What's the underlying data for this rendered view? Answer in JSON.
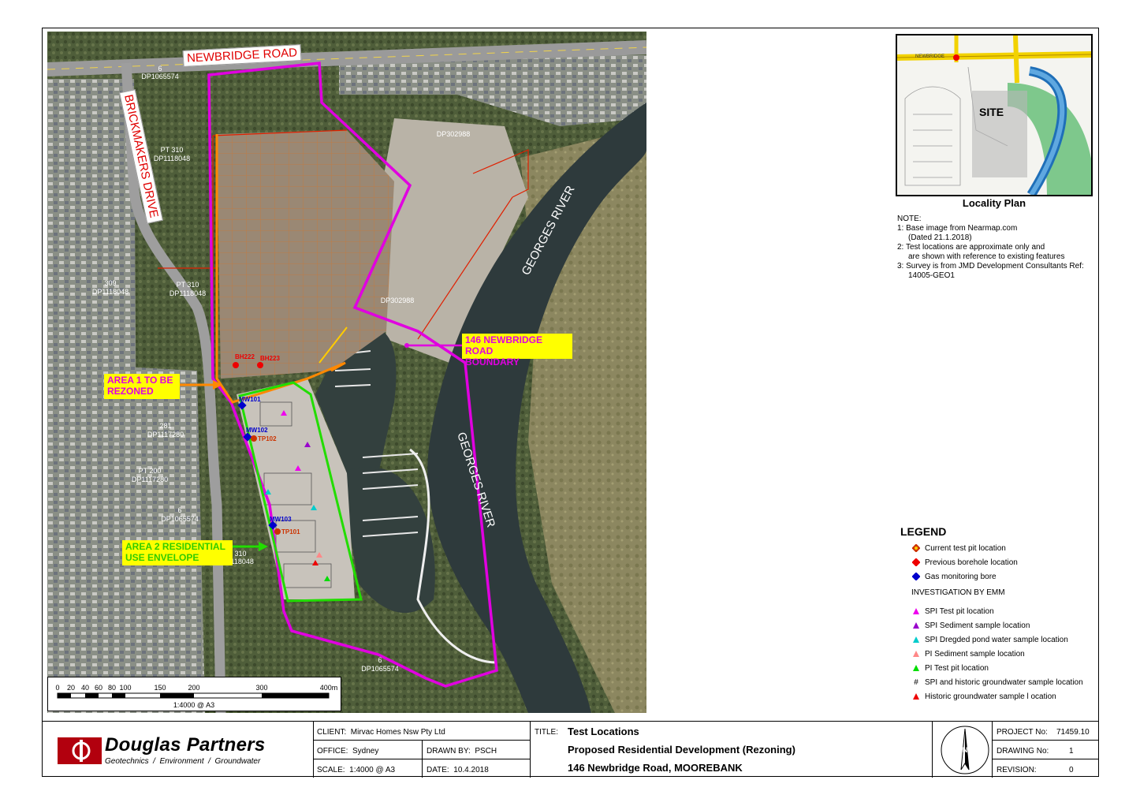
{
  "map": {
    "roads": {
      "newbridge": "NEWBRIDGE ROAD",
      "brickmakers": "BRICKMAKERS DRIVE"
    },
    "lots": [
      "6",
      "DP1065574",
      "PT 310",
      "DP1118048",
      "309",
      "DP1118048",
      "PT 310",
      "DP1118048",
      "DP302988",
      "DP302988",
      "281",
      "DP1117280",
      "PT 200",
      "DP1117280",
      "6",
      "DP1065574",
      "310",
      "1118048",
      "6",
      "DP1065574"
    ],
    "river": [
      "GEORGES RIVER",
      "GEORGES RIVER"
    ],
    "callouts": {
      "boundary": "146 NEWBRIDGE ROAD BOUNDARY",
      "boundary_l1": "146 NEWBRIDGE ROAD",
      "boundary_l2": "BOUNDARY",
      "area1_l1": "AREA 1 TO BE",
      "area1_l2": "REZONED",
      "area2_l1": "AREA 2 RESIDENTIAL",
      "area2_l2": "USE ENVELOPE"
    },
    "points": [
      "BH222",
      "BH223",
      "MW101",
      "MW102",
      "TP102",
      "MW103",
      "TP101"
    ],
    "colors": {
      "boundary": "#e000e0",
      "area1": "#ff8800",
      "area2": "#22dd00",
      "lots": "#dd2200"
    }
  },
  "scale_bar": {
    "ticks": [
      "0",
      "20",
      "40",
      "60",
      "80",
      "100",
      "150",
      "200",
      "300",
      "400m"
    ],
    "caption": "1:4000 @ A3"
  },
  "locality": {
    "site_label": "SITE",
    "title": "Locality Plan",
    "street": "NEWBRIDGE"
  },
  "notes": {
    "heading": "NOTE:",
    "items": [
      [
        "1:  Base image from Nearmap.com",
        "(Dated 21.1.2018)"
      ],
      [
        "2:  Test locations are approximate only and",
        "are shown with reference to existing features"
      ],
      [
        "3:  Survey is from JMD Development Consultants Ref:",
        "14005-GEO1"
      ]
    ]
  },
  "legend": {
    "title": "LEGEND",
    "items": [
      {
        "label": "Current test pit location",
        "color": "#cc3300",
        "shape": "diamond-dot"
      },
      {
        "label": "Previous borehole location",
        "color": "#ee0000",
        "shape": "diamond"
      },
      {
        "label": "Gas monitoring bore",
        "color": "#0000cc",
        "shape": "diamond"
      }
    ],
    "sub": "INVESTIGATION BY EMM",
    "emm": [
      {
        "label": "SPI Test pit location",
        "color": "#ee00ee",
        "shape": "triangle"
      },
      {
        "label": "SPI Sediment sample location",
        "color": "#9900cc",
        "shape": "triangle"
      },
      {
        "label": "SPI Dregded pond water sample location",
        "color": "#00cccc",
        "shape": "triangle"
      },
      {
        "label": "PI Sediment sample location",
        "color": "#ff8888",
        "shape": "triangle"
      },
      {
        "label": "PI Test pit location",
        "color": "#00dd00",
        "shape": "triangle"
      },
      {
        "label": "SPI and historic groundwater sample location",
        "color": "#000000",
        "shape": "hash"
      },
      {
        "label": "Historic groundwater sample l ocation",
        "color": "#ee0000",
        "shape": "triangle"
      }
    ]
  },
  "title_block": {
    "logo_name": "Douglas Partners",
    "logo_tag": "Geotechnics  /  Environment  /  Groundwater",
    "client_label": "CLIENT:",
    "client": "Mirvac Homes Nsw Pty Ltd",
    "office_label": "OFFICE:",
    "office": "Sydney",
    "drawn_label": "DRAWN BY:",
    "drawn": "PSCH",
    "scale_label": "SCALE:",
    "scale": "1:4000 @ A3",
    "date_label": "DATE:",
    "date": "10.4.2018",
    "title_label": "TITLE:",
    "title_1": "Test Locations",
    "title_2": "Proposed Residential Development (Rezoning)",
    "title_3": "146 Newbridge Road, MOOREBANK",
    "north": "N",
    "project_label": "PROJECT No:",
    "project": "71459.10",
    "drawing_label": "DRAWING No:",
    "drawing": "1",
    "revision_label": "REVISION:",
    "revision": "0"
  }
}
